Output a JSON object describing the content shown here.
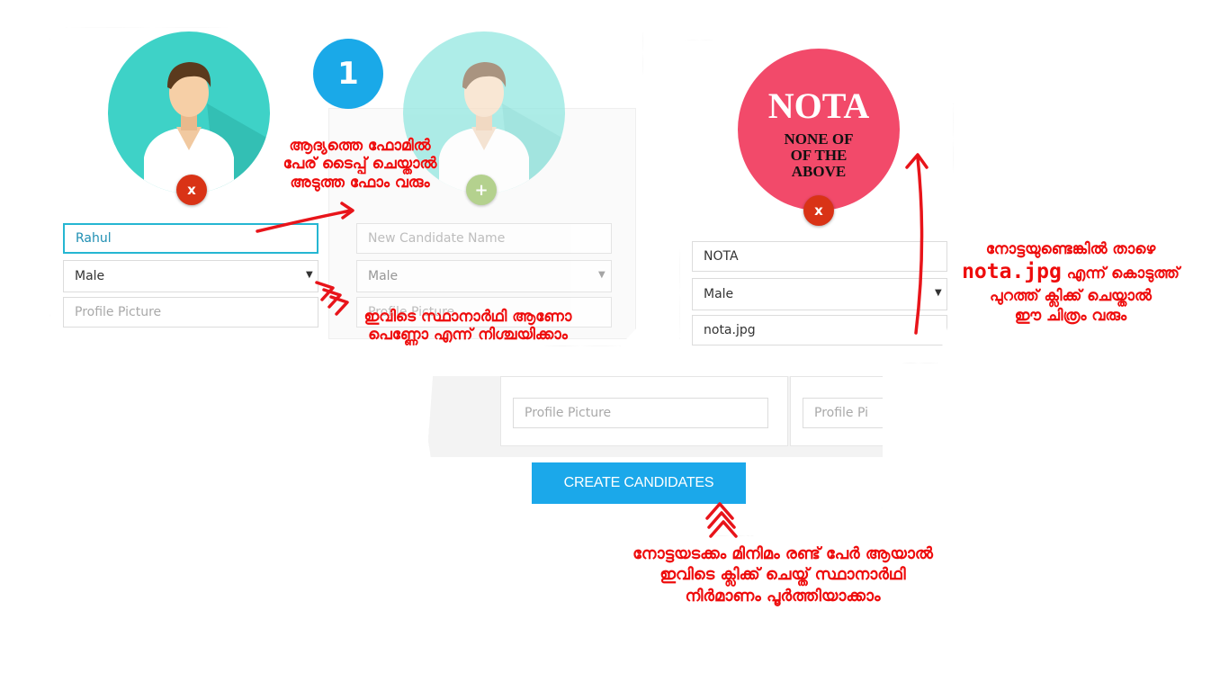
{
  "step_badge": "1",
  "candidate_form_1": {
    "name_value": "Rahul",
    "gender_value": "Male",
    "picture_placeholder": "Profile Picture",
    "remove_label": "x"
  },
  "candidate_form_2": {
    "name_placeholder": "New Candidate Name",
    "gender_value": "Male",
    "picture_placeholder": "Profile Picture",
    "add_label": "+"
  },
  "nota_form": {
    "avatar_title": "NOTA",
    "avatar_line1": "NONE OF",
    "avatar_line2": "OF THE",
    "avatar_line3": "ABOVE",
    "name_value": "NOTA",
    "gender_value": "Male",
    "picture_value": "nota.jpg",
    "remove_label": "x"
  },
  "lower_forms": {
    "picture_placeholder_1": "Profile Picture",
    "picture_placeholder_2": "Profile Pi"
  },
  "create_button_label": "CREATE CANDIDATES",
  "annotations": {
    "first_form_note": [
      "ആദ്യത്തെ ഫോമിൽ",
      "പേര് ടൈപ്പ് ചെയ്താൽ",
      "അടുത്ത ഫോം വരും"
    ],
    "gender_note": [
      "ഇവിടെ സ്ഥാനാർഥി ആണോ",
      "പെണ്ണോ എന്ന് നിശ്ചയിക്കാം"
    ],
    "nota_note_line1": "നോട്ടയുണ്ടെങ്കിൽ താഴെ",
    "nota_note_file": "nota.jpg",
    "nota_note_line2_rest": " എന്ന് കൊടുത്ത്",
    "nota_note_line3": "പുറത്ത് ക്ലിക്ക് ചെയ്താൽ",
    "nota_note_line4": "ഈ ചിത്രം വരും",
    "create_note": [
      "നോട്ടയടക്കം മിനിമം രണ്ട് പേർ ആയാൽ",
      "ഇവിടെ ക്ലിക്ക് ചെയ്ത് സ്ഥാനാർഥി",
      "നിർമാണം പൂർത്തിയാക്കാം"
    ]
  },
  "colors": {
    "avatar_teal": "#3ed2c7",
    "avatar_teal_faded": "#93e7e0",
    "step_badge_blue": "#1aa9e8",
    "remove_red": "#d93316",
    "add_green": "#9dc46a",
    "nota_pink": "#f24a6a",
    "create_blue": "#1ba8ea",
    "annotation_red": "#ee0c0c"
  }
}
